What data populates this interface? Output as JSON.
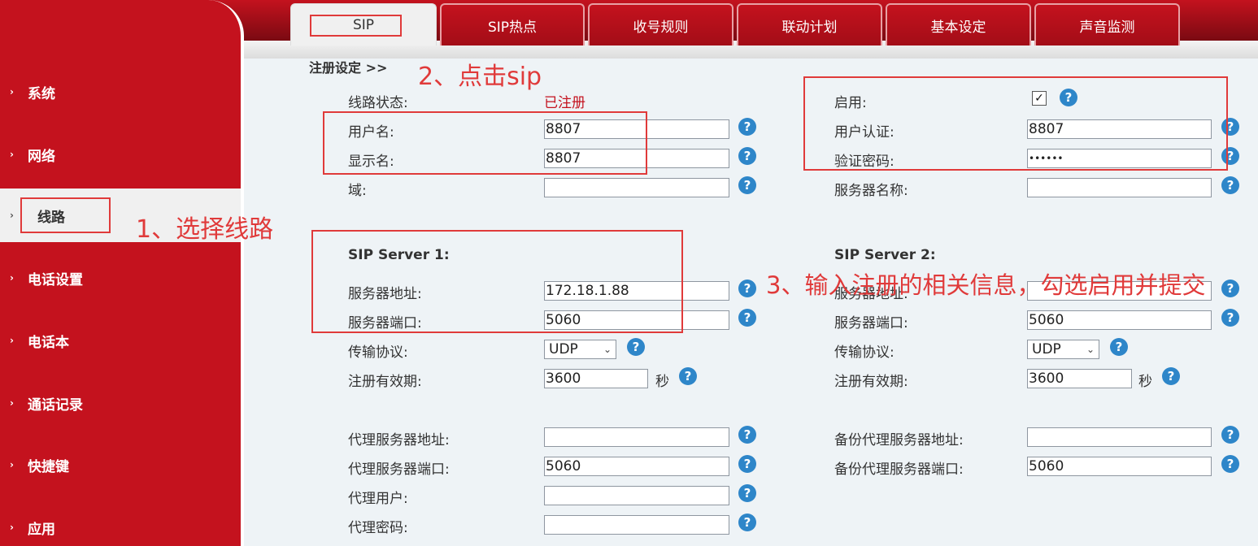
{
  "sidebar": {
    "items": [
      {
        "label": "系统"
      },
      {
        "label": "网络"
      },
      {
        "label": "线路"
      },
      {
        "label": "电话设置"
      },
      {
        "label": "电话本"
      },
      {
        "label": "通话记录"
      },
      {
        "label": "快捷键"
      },
      {
        "label": "应用"
      }
    ]
  },
  "tabs": [
    {
      "label": "SIP"
    },
    {
      "label": "SIP热点"
    },
    {
      "label": "收号规则"
    },
    {
      "label": "联动计划"
    },
    {
      "label": "基本设定"
    },
    {
      "label": "声音监测"
    }
  ],
  "breadcrumb": "注册设定 >>",
  "left": {
    "line_status_label": "线路状态:",
    "line_status_value": "已注册",
    "username_label": "用户名:",
    "username_value": "8807",
    "display_label": "显示名:",
    "display_value": "8807",
    "domain_label": "域:",
    "domain_value": ""
  },
  "right": {
    "enable_label": "启用:",
    "enable_checked": "☑",
    "auth_user_label": "用户认证:",
    "auth_user_value": "8807",
    "auth_pass_label": "验证密码:",
    "auth_pass_value": "••••••",
    "server_name_label": "服务器名称:",
    "server_name_value": ""
  },
  "server1": {
    "title": "SIP Server 1:",
    "addr_label": "服务器地址:",
    "addr_value": "172.18.1.88",
    "port_label": "服务器端口:",
    "port_value": "5060",
    "transport_label": "传输协议:",
    "transport_value": "UDP",
    "expire_label": "注册有效期:",
    "expire_value": "3600",
    "expire_unit": "秒"
  },
  "server2": {
    "title": "SIP Server 2:",
    "addr_label": "服务器地址:",
    "addr_value": "",
    "port_label": "服务器端口:",
    "port_value": "5060",
    "transport_label": "传输协议:",
    "transport_value": "UDP",
    "expire_label": "注册有效期:",
    "expire_value": "3600",
    "expire_unit": "秒"
  },
  "proxy": {
    "addr_label": "代理服务器地址:",
    "addr_value": "",
    "port_label": "代理服务器端口:",
    "port_value": "5060",
    "user_label": "代理用户:",
    "user_value": "",
    "pass_label": "代理密码:",
    "pass_value": ""
  },
  "backup_proxy": {
    "addr_label": "备份代理服务器地址:",
    "addr_value": "",
    "port_label": "备份代理服务器端口:",
    "port_value": "5060"
  },
  "annotations": {
    "step1": "1、选择线路",
    "step2": "2、点击sip",
    "step3": "3、输入注册的相关信息，勾选启用并提交"
  },
  "colors": {
    "brand_red": "#c4121e",
    "annotation_red": "#e03a3a",
    "help_blue": "#2e86c9",
    "status_red": "#c4121e"
  },
  "help_glyph": "?"
}
